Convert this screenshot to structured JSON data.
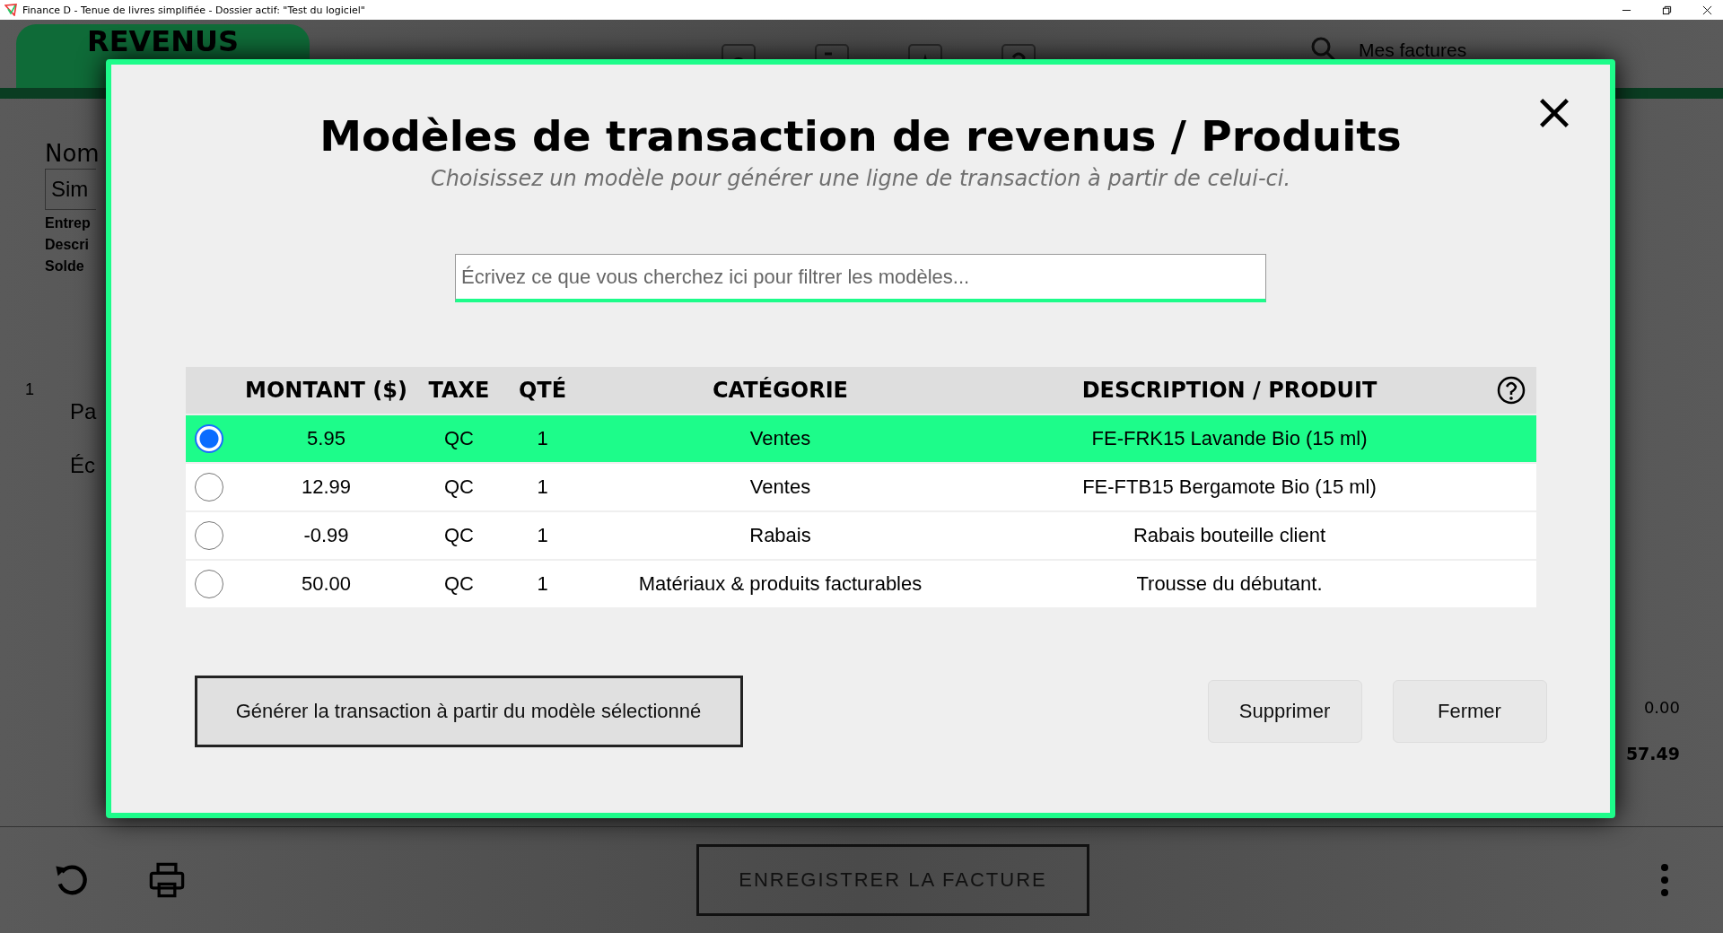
{
  "window": {
    "title": "Finance D - Tenue de livres simplifiée - Dossier actif: \"Test du logiciel\""
  },
  "background": {
    "tab": "REVENUS",
    "search_label": "Mes factures",
    "name_label": "Nom",
    "name_value": "Sim",
    "info_labels": [
      "Entrep",
      "Descri",
      "Solde"
    ],
    "line_number": "1",
    "side_labels": [
      "Pa",
      "Éc"
    ],
    "totals": [
      "0.00",
      "57.49"
    ],
    "save_button": "ENREGISTRER LA FACTURE"
  },
  "dialog": {
    "title": "Modèles de transaction de revenus / Produits",
    "subtitle": "Choisissez un modèle pour générer une ligne de transaction à partir de celui-ci.",
    "search": {
      "placeholder": "Écrivez ce que vous cherchez ici pour filtrer les modèles..."
    },
    "columns": [
      "MONTANT ($)",
      "TAXE",
      "QTÉ",
      "CATÉGORIE",
      "DESCRIPTION / PRODUIT"
    ],
    "rows": [
      {
        "amount": "5.95",
        "tax": "QC",
        "qty": "1",
        "category": "Ventes",
        "description": "FE-FRK15 Lavande Bio (15 ml)",
        "selected": true
      },
      {
        "amount": "12.99",
        "tax": "QC",
        "qty": "1",
        "category": "Ventes",
        "description": "FE-FTB15 Bergamote Bio (15 ml)",
        "selected": false
      },
      {
        "amount": "-0.99",
        "tax": "QC",
        "qty": "1",
        "category": "Rabais",
        "description": "Rabais bouteille client",
        "selected": false
      },
      {
        "amount": "50.00",
        "tax": "QC",
        "qty": "1",
        "category": "Matériaux & produits facturables",
        "description": "Trousse du débutant.",
        "selected": false
      }
    ],
    "buttons": {
      "generate": "Générer la transaction à partir du modèle sélectionné",
      "delete": "Supprimer",
      "close": "Fermer"
    }
  }
}
